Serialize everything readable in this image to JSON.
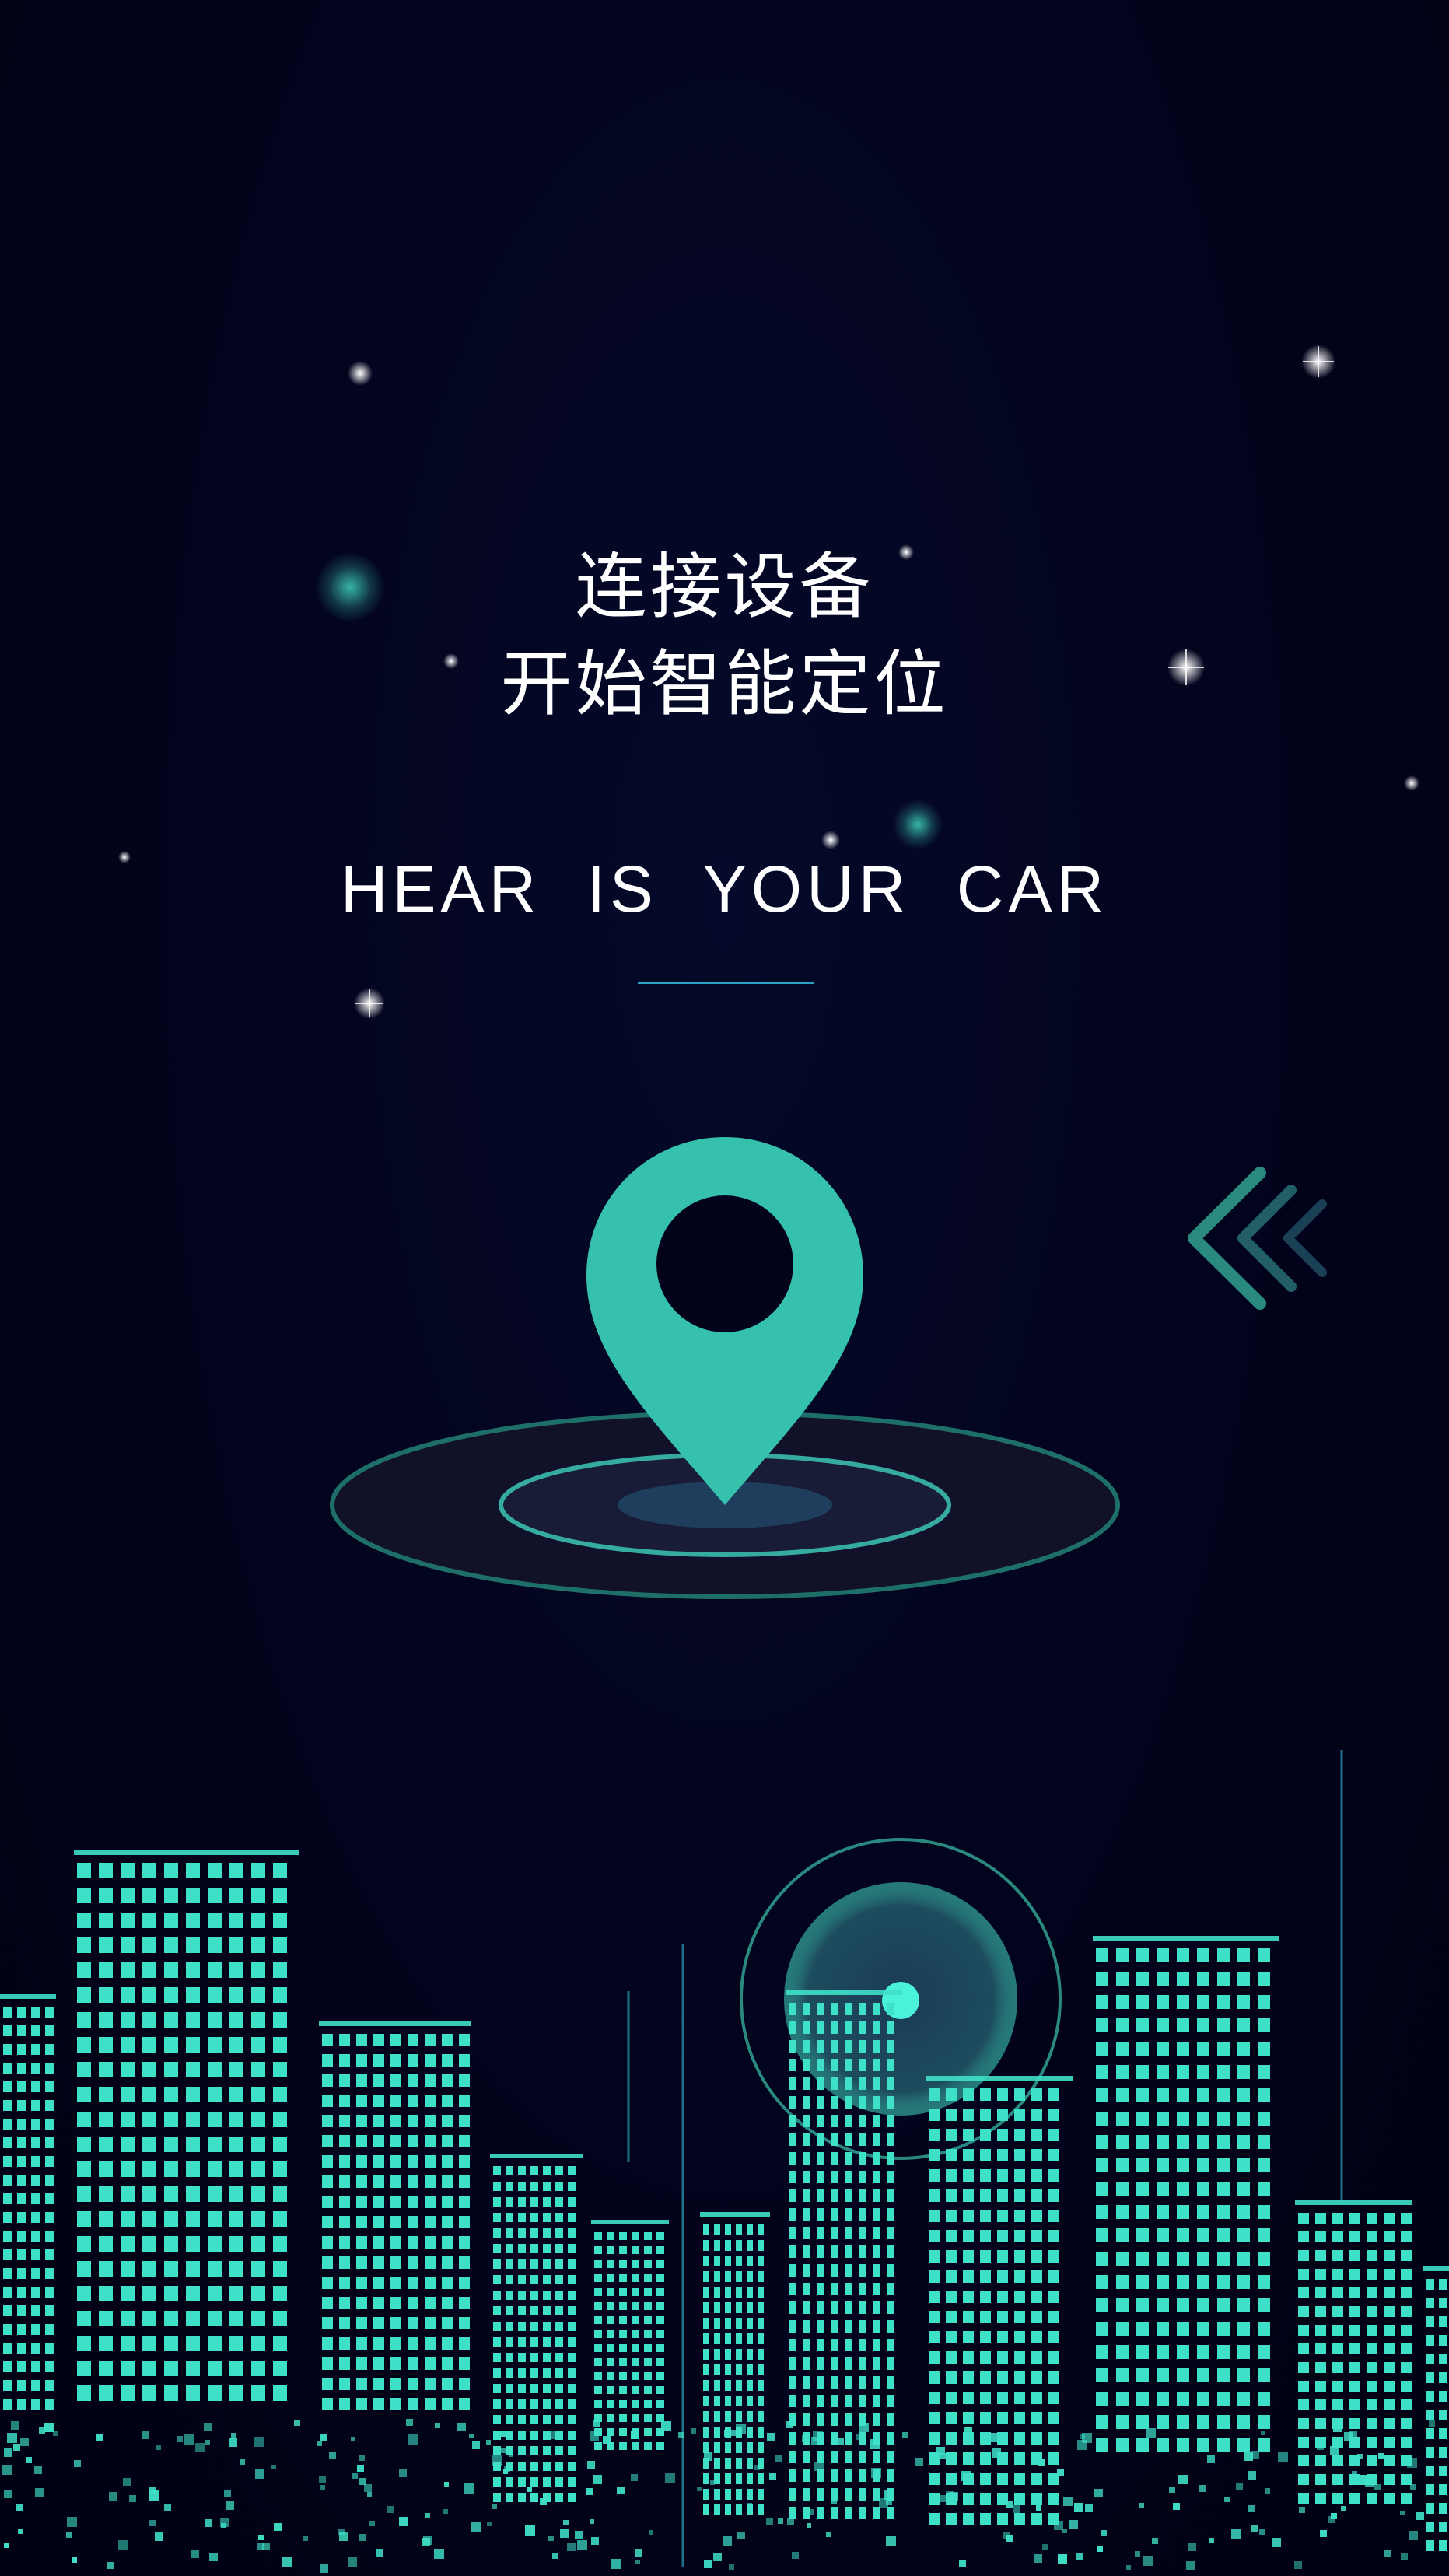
{
  "intro": {
    "title_line1": "连接设备",
    "title_line2": "开始智能定位",
    "tagline": "HEAR IS YOUR CAR"
  },
  "icons": {
    "pin": "location-pin-icon",
    "arrows": "triple-chevron-left-icon",
    "radar": "radar-signal-icon"
  },
  "colors": {
    "background": "#02021a",
    "accent": "#3cc8b4",
    "underline": "#2aa3c4",
    "text": "#ffffff"
  }
}
